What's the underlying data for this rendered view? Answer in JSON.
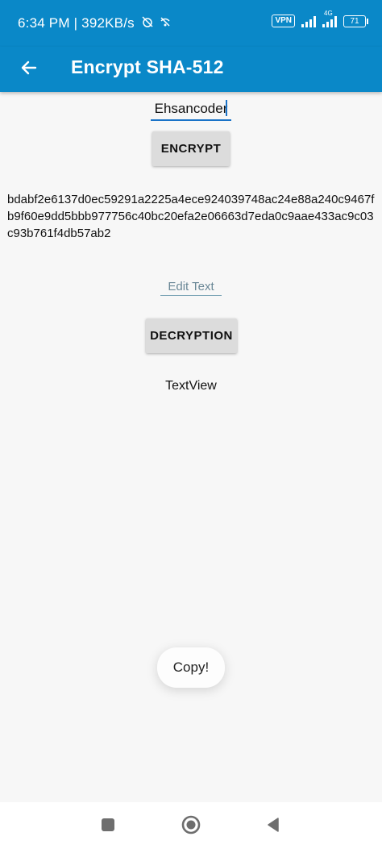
{
  "status_bar": {
    "time_speed": "6:34 PM | 392KB/s",
    "vpn": "VPN",
    "network": "4G",
    "battery": "71",
    "icons": [
      "alarm-off-icon",
      "wifi-off-icon",
      "signal-icon",
      "battery-icon"
    ]
  },
  "app_bar": {
    "title": "Encrypt SHA-512",
    "back_icon": "arrow-back-icon",
    "color": "#0a88c8"
  },
  "input_top": {
    "value": "Ehsancoder"
  },
  "encrypt_button": {
    "label": "ENCRYPT"
  },
  "hash_output": {
    "text": "bdabf2e6137d0ec59291a2225a4ece924039748ac24e88a240c9467fb9f60e9dd5bbb977756c40bc20efa2e06663d7eda0c9aae433ac9c03c93b761f4db57ab2"
  },
  "input_bottom": {
    "placeholder": "Edit Text"
  },
  "decrypt_button": {
    "label": "DECRYPTION"
  },
  "result_text": {
    "text": "TextView"
  },
  "toast": {
    "text": "Copy!"
  },
  "nav_bar": {
    "icons": [
      "recents-icon",
      "home-icon",
      "back-triangle-icon"
    ]
  }
}
